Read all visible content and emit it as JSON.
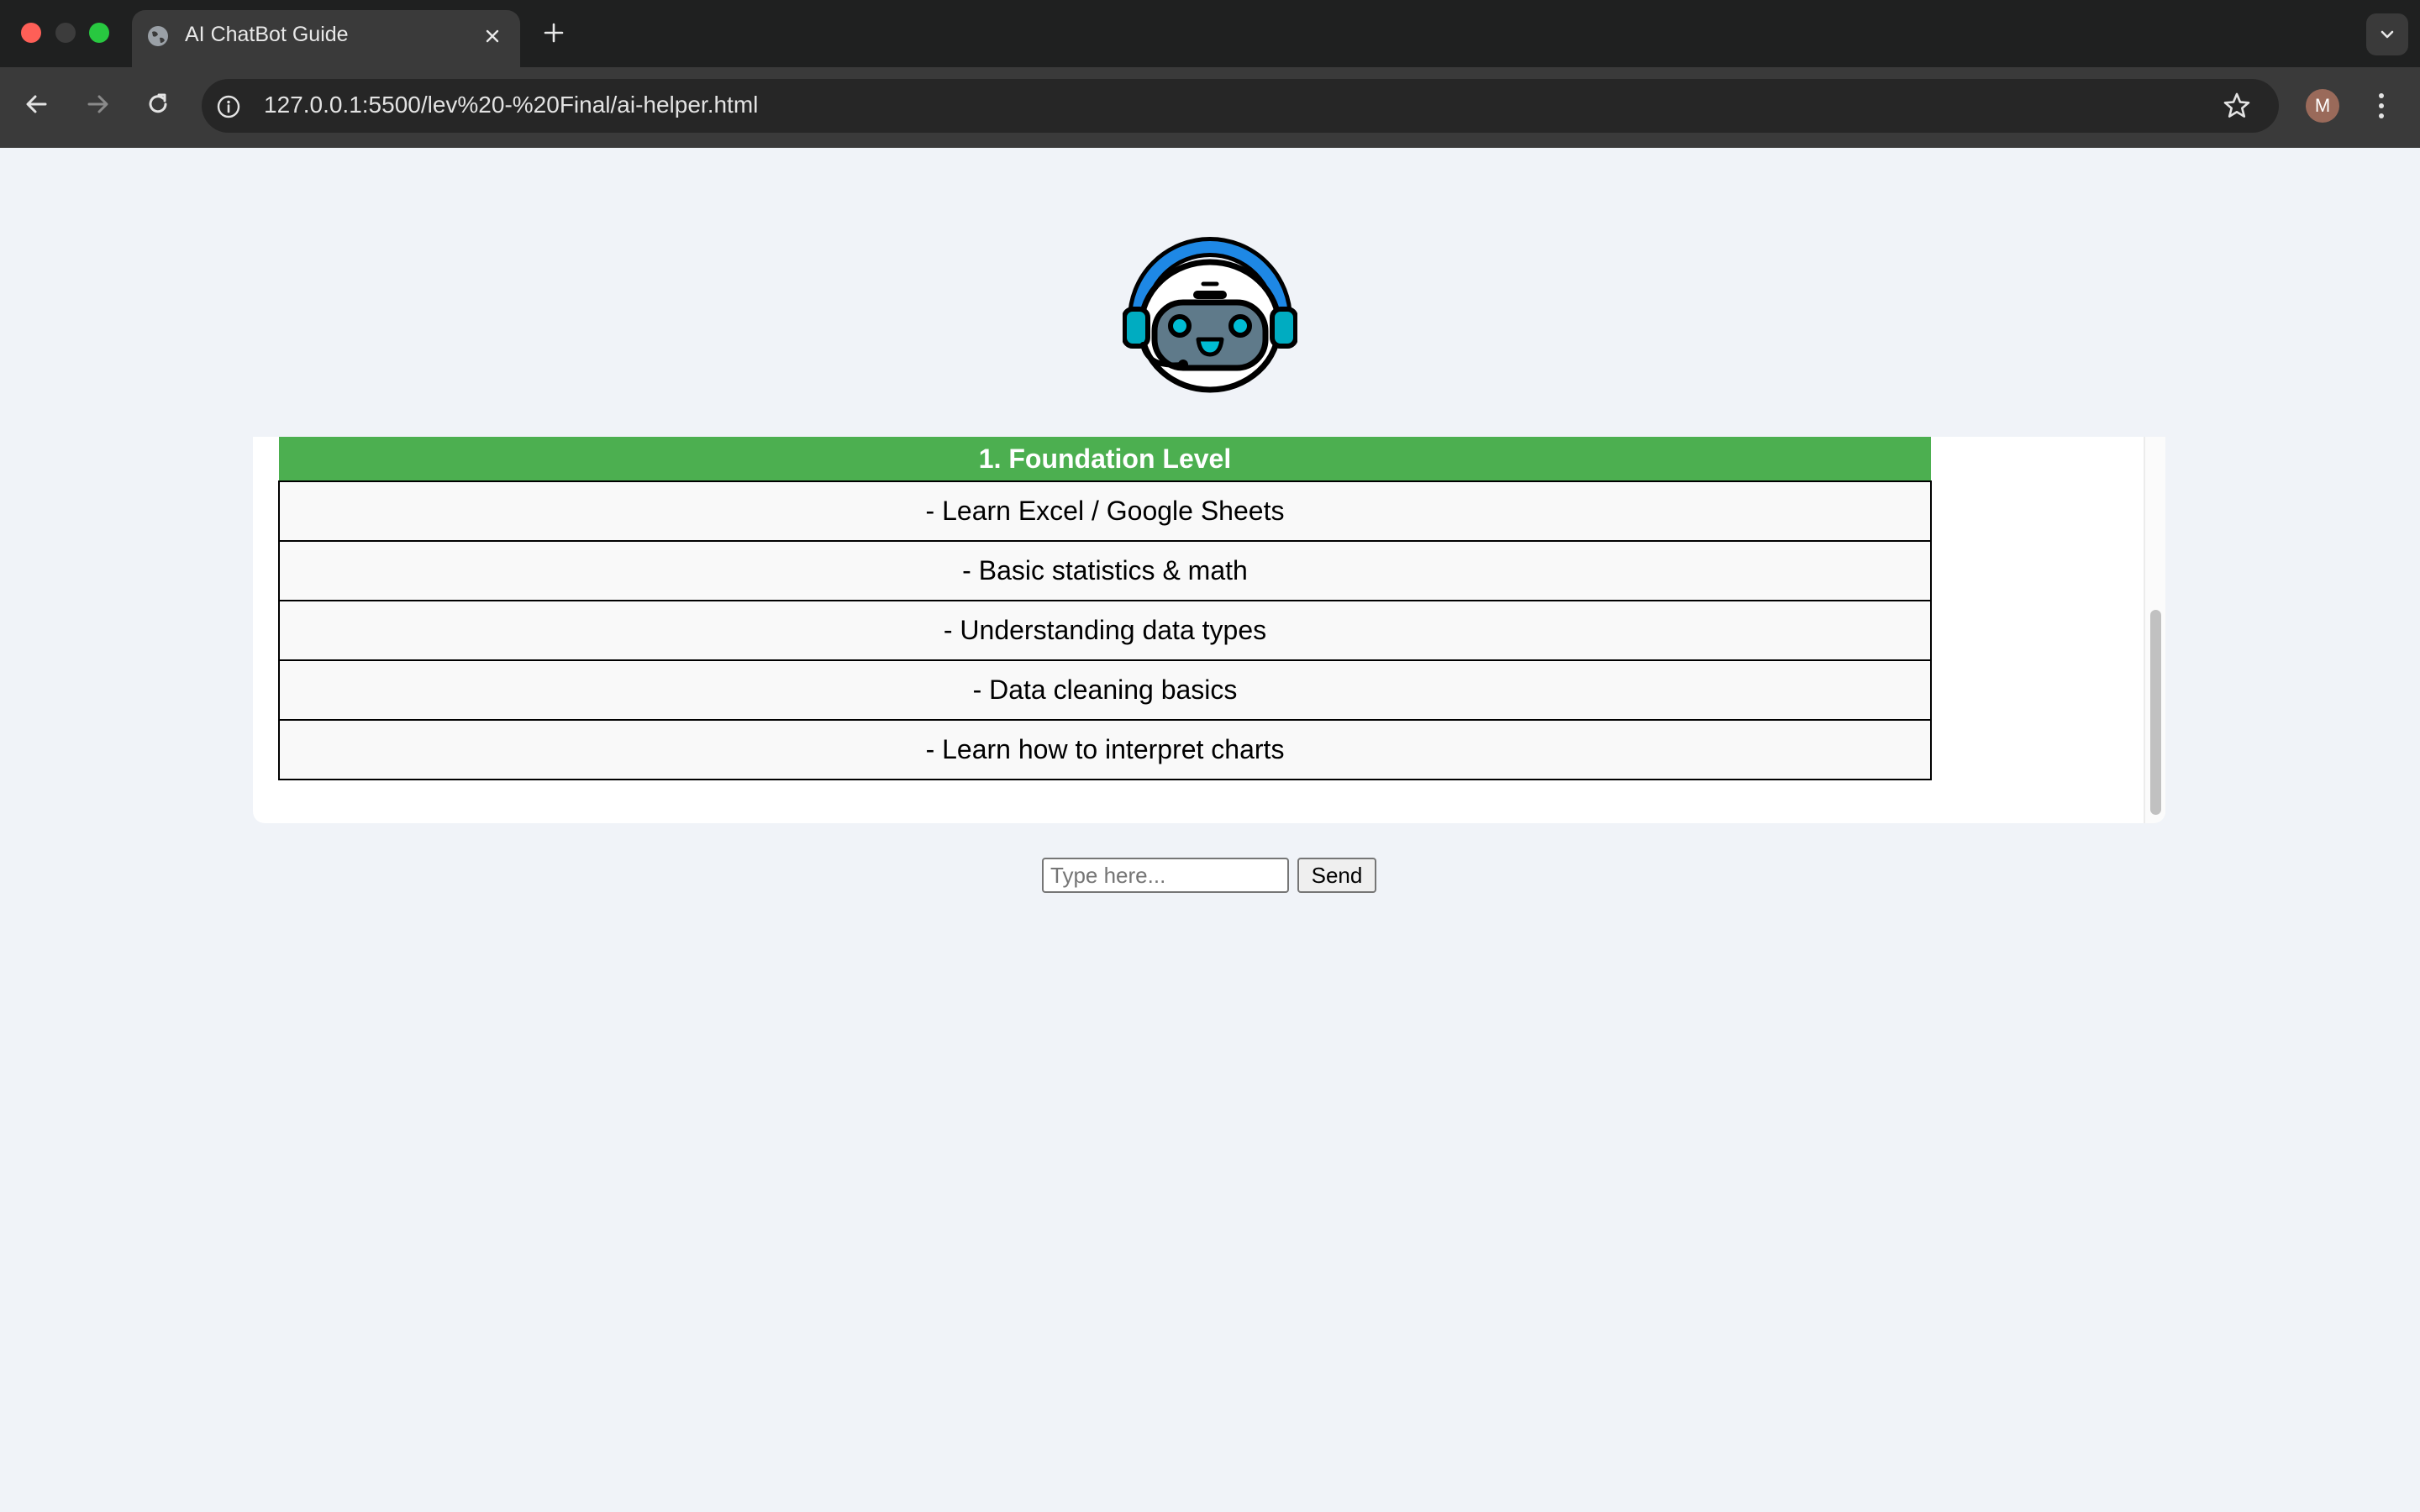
{
  "browser": {
    "tab": {
      "title": "AI ChatBot Guide",
      "icon": "globe-icon"
    },
    "address_bar": {
      "url": "127.0.0.1:5500/lev%20-%20Final/ai-helper.html"
    },
    "profile": {
      "initial": "M"
    },
    "colors": {
      "tabstrip": "#1f2020",
      "toolbar": "#3a3a3a"
    }
  },
  "page": {
    "logo": "headset-robot-icon",
    "roadmap": {
      "header": "1. Foundation Level",
      "items": [
        "- Learn Excel / Google Sheets",
        "- Basic statistics & math",
        "- Understanding data types",
        "- Data cleaning basics",
        "- Learn how to interpret charts"
      ]
    },
    "chat": {
      "input_placeholder": "Type here...",
      "input_value": "",
      "send_label": "Send"
    },
    "colors": {
      "background": "#f0f3f8",
      "header_green": "#4caf50",
      "row_background": "#f9f9f9"
    }
  }
}
